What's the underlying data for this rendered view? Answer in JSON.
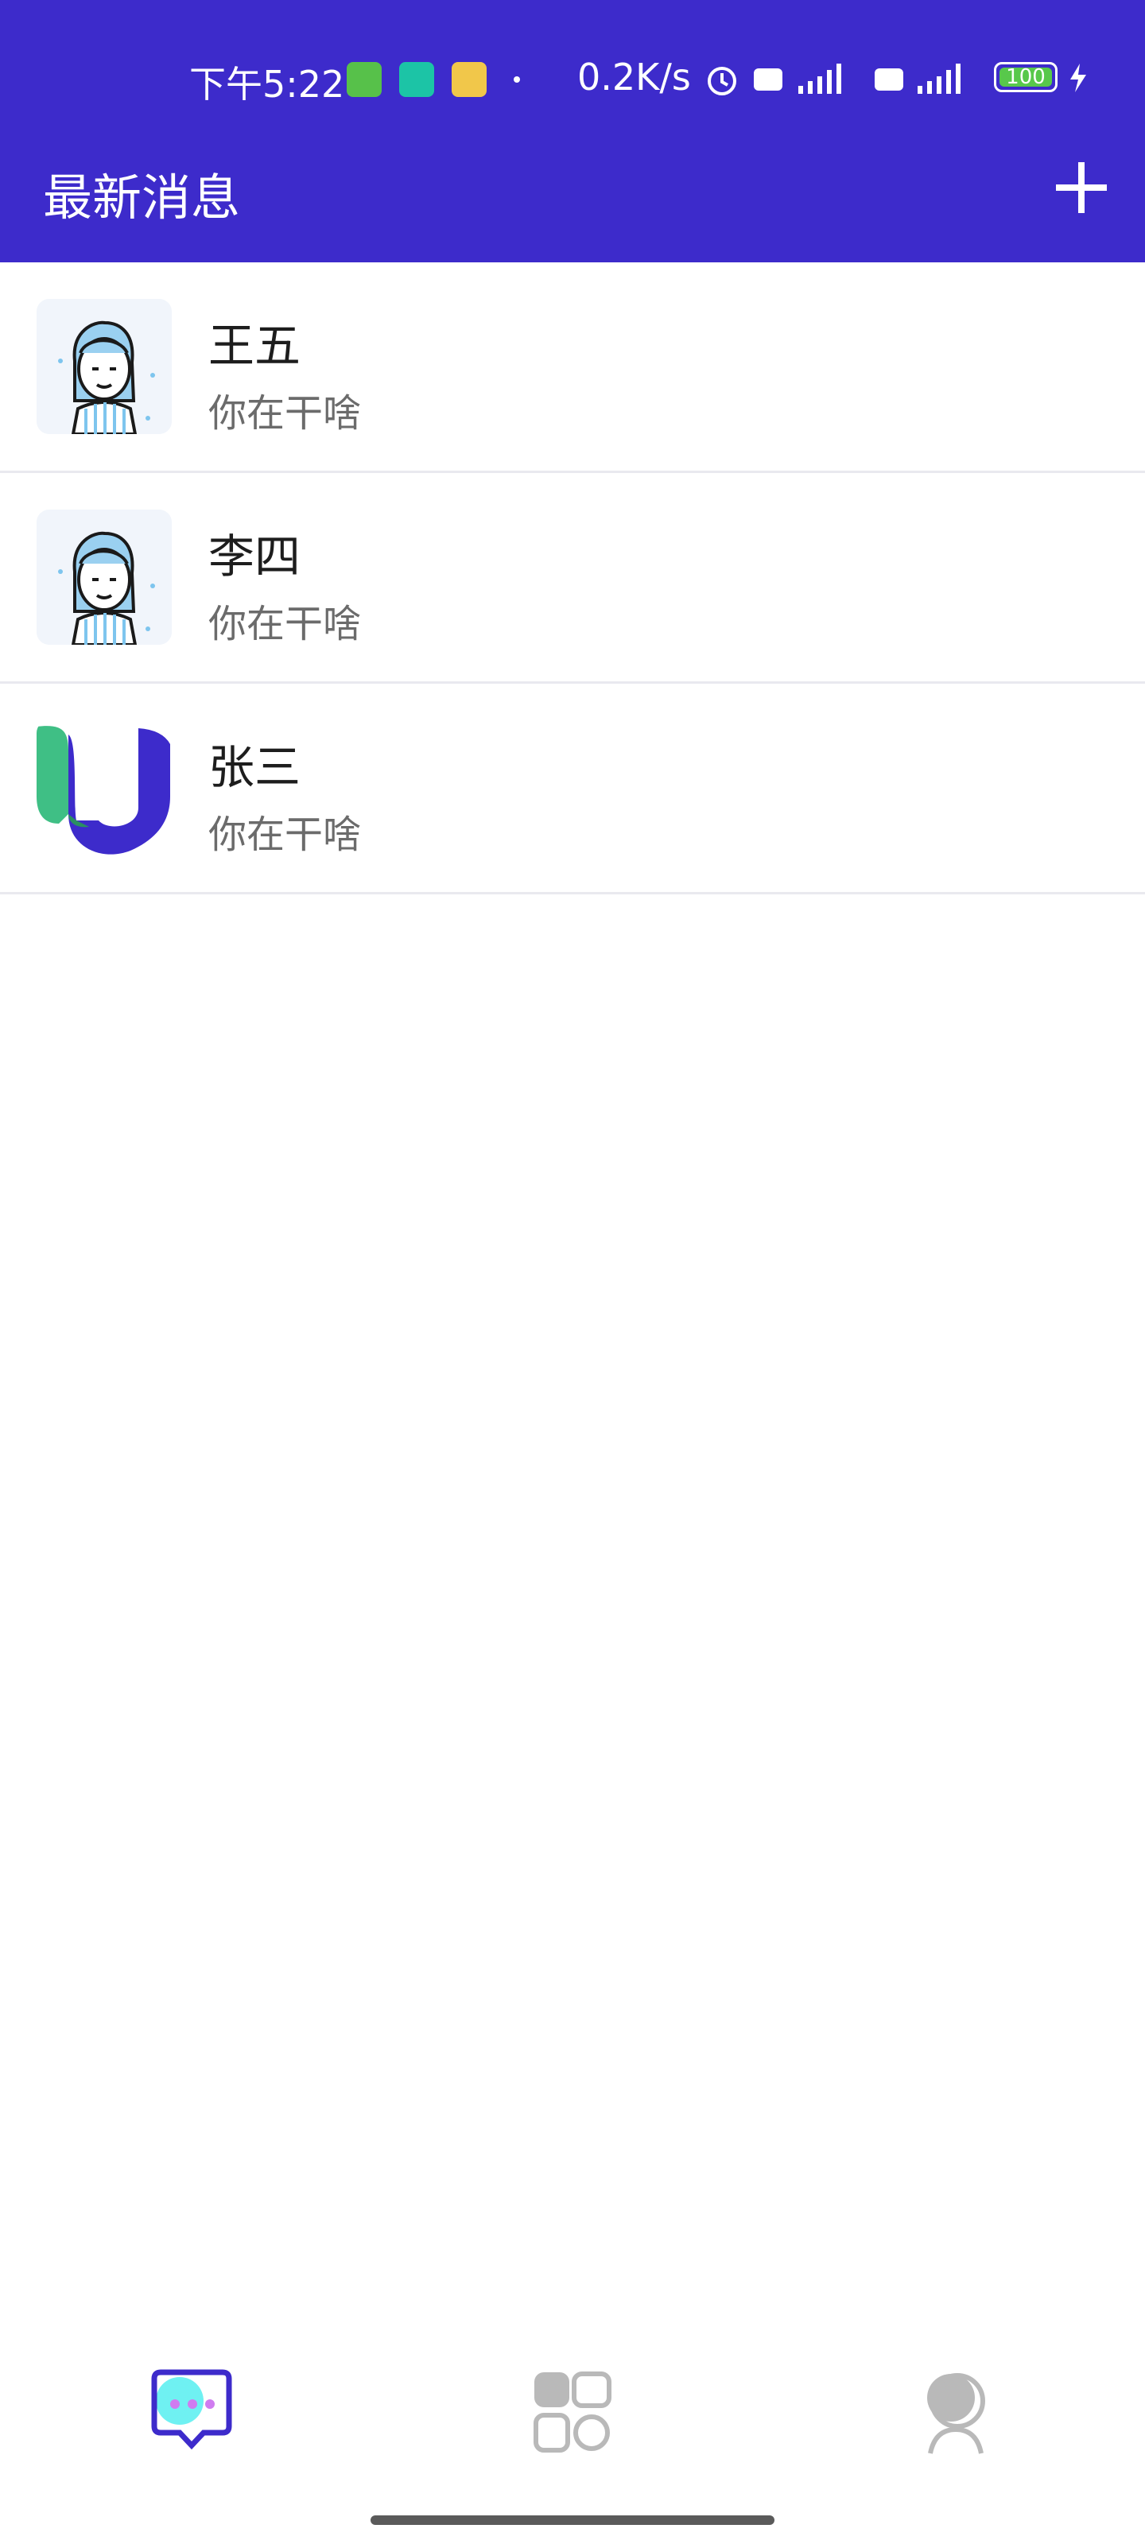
{
  "status_bar": {
    "time": "下午5:22",
    "net_speed": "0.2K/s",
    "battery": "100"
  },
  "header": {
    "title": "最新消息"
  },
  "conversations": [
    {
      "name": "王五",
      "preview": "你在干啥",
      "avatar": "woman-avatar-icon"
    },
    {
      "name": "李四",
      "preview": "你在干啥",
      "avatar": "woman-avatar-icon"
    },
    {
      "name": "张三",
      "preview": "你在干啥",
      "avatar": "u-logo-icon"
    }
  ],
  "bottom_nav": {
    "items": [
      {
        "icon": "chat-icon",
        "active": true
      },
      {
        "icon": "apps-icon",
        "active": false
      },
      {
        "icon": "profile-icon",
        "active": false
      }
    ]
  },
  "colors": {
    "primary": "#3d2bcb",
    "accent_green": "#3fbf85",
    "inactive": "#b9b9b9"
  }
}
